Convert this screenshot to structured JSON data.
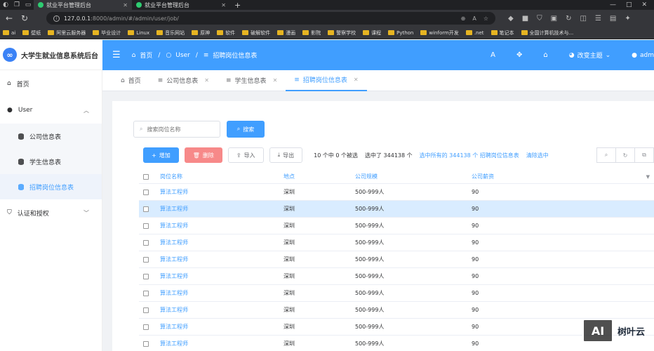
{
  "browser": {
    "tabs": [
      {
        "title": "就业平台管理后台",
        "active": true
      },
      {
        "title": "就业平台管理后台",
        "active": false
      }
    ],
    "url_host": "127.0.0.1",
    "url_rest": ":8000/admin/#/admin/user/job/",
    "bookmarks": [
      "ai",
      "壁纸",
      "阿里云服务器",
      "毕业设计",
      "Linux",
      "音乐网站",
      "原神",
      "软件",
      "破解软件",
      "漫画",
      "影院",
      "警察学校",
      "课程",
      "Python",
      "winform开发",
      ".net",
      "笔记本",
      "全国计算机技术与..."
    ]
  },
  "brand": {
    "title": "大学生就业信息系统后台",
    "logo_glyph": "∞"
  },
  "header": {
    "breadcrumb": [
      "首页",
      "User",
      "招聘岗位信息表"
    ],
    "theme_label": "改变主题",
    "user_label": "adm"
  },
  "sidebar": {
    "home": "首页",
    "user_group": "User",
    "sub_items": [
      "公司信息表",
      "学生信息表",
      "招聘岗位信息表"
    ],
    "auth_group": "认证和授权"
  },
  "tags": [
    {
      "label": "首页",
      "closable": false
    },
    {
      "label": "公司信息表",
      "closable": true
    },
    {
      "label": "学生信息表",
      "closable": true
    },
    {
      "label": "招聘岗位信息表",
      "closable": true,
      "active": true
    }
  ],
  "search": {
    "placeholder": "搜索岗位名称",
    "button": "搜索"
  },
  "toolbar": {
    "add": "增加",
    "delete": "删除",
    "import": "导入",
    "export": "导出",
    "selection_count": "10 个中 0 个被选",
    "selected_total": "选中了 344138 个",
    "select_all": "选中所有的 344138 个 招聘岗位信息表",
    "clear": "清除选中"
  },
  "table": {
    "headers": [
      "岗位名称",
      "地点",
      "公司规模",
      "公司薪资"
    ],
    "rows": [
      [
        "算法工程师",
        "深圳",
        "500-999人",
        "90"
      ],
      [
        "算法工程师",
        "深圳",
        "500-999人",
        "90"
      ],
      [
        "算法工程师",
        "深圳",
        "500-999人",
        "90"
      ],
      [
        "算法工程师",
        "深圳",
        "500-999人",
        "90"
      ],
      [
        "算法工程师",
        "深圳",
        "500-999人",
        "90"
      ],
      [
        "算法工程师",
        "深圳",
        "500-999人",
        "90"
      ],
      [
        "算法工程师",
        "深圳",
        "500-999人",
        "90"
      ],
      [
        "算法工程师",
        "深圳",
        "500-999人",
        "90"
      ],
      [
        "算法工程师",
        "深圳",
        "500-999人",
        "90"
      ],
      [
        "算法工程师",
        "深圳",
        "500-999人",
        "90"
      ]
    ],
    "highlighted_row": 1
  },
  "watermark": {
    "box": "AI",
    "text": "树叶云"
  },
  "colors": {
    "primary": "#409eff",
    "danger": "#f78989",
    "highlight": "#d9ecff"
  }
}
